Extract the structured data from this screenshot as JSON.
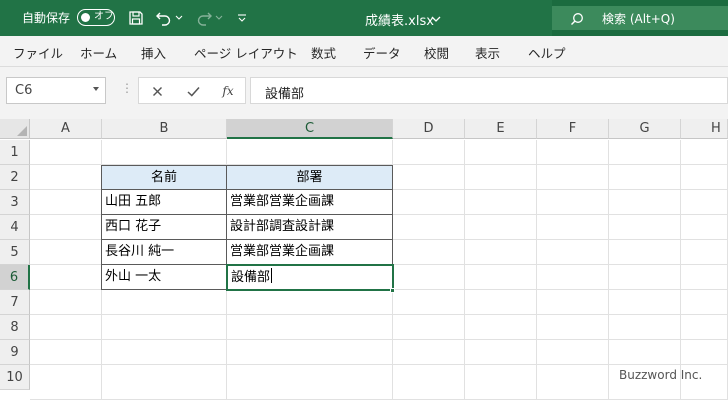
{
  "titlebar": {
    "autosave_label": "自動保存",
    "autosave_state": "オフ",
    "doc_title": "成績表.xlsx",
    "search_text": "検索 (Alt+Q)",
    "bg_color": "#217346"
  },
  "ribbon": {
    "tabs": [
      "ファイル",
      "ホーム",
      "挿入",
      "ページ レイアウト",
      "数式",
      "データ",
      "校閲",
      "表示",
      "ヘルプ"
    ]
  },
  "formula_bar": {
    "name_box": "C6",
    "fx_label": "fx",
    "formula": "設備部"
  },
  "sheet": {
    "columns": [
      "A",
      "B",
      "C",
      "D",
      "E",
      "F",
      "G",
      "H"
    ],
    "rows": [
      "1",
      "2",
      "3",
      "4",
      "5",
      "6",
      "7",
      "8",
      "9",
      "10"
    ],
    "selected_cell": "C6",
    "header_fill": "#ddebf7",
    "selection_color": "#217346",
    "table": {
      "headers": [
        "名前",
        "部署"
      ],
      "rows": [
        [
          "山田 五郎",
          "営業部営業企画課"
        ],
        [
          "西口 花子",
          "設計部調査設計課"
        ],
        [
          "長谷川 純一",
          "営業部営業企画課"
        ],
        [
          "外山 一太",
          "設備部"
        ]
      ]
    }
  },
  "watermark": "Buzzword Inc."
}
